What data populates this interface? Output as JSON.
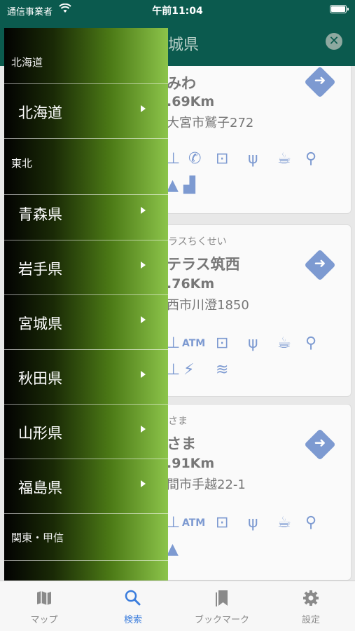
{
  "status_bar": {
    "carrier": "通信事業者",
    "time": "午前11:04"
  },
  "navbar": {
    "title": "城県"
  },
  "cards": [
    {
      "kana": "",
      "name": "みわ",
      "distance": ".69Km",
      "address": "大宮市鷲子272",
      "facilities": [
        "toilet-icon",
        "phone-icon",
        "shopping-bag-icon",
        "restaurant-icon",
        "cafe-icon",
        "water-tap-icon",
        "hill-icon",
        "landscape-icon"
      ]
    },
    {
      "kana": "ラスちくせい",
      "name": "テラス筑西",
      "distance": ".76Km",
      "address": "西市川澄1850",
      "facilities": [
        "toilet-icon",
        "atm-icon",
        "shopping-bag-icon",
        "restaurant-icon",
        "cafe-icon",
        "water-tap-icon",
        "toilet-icon",
        "ev-charger-icon",
        "wifi-icon"
      ],
      "atm_label": "ATM"
    },
    {
      "kana": "さま",
      "name": "さま",
      "distance": ".91Km",
      "address": "間市手越22-1",
      "facilities": [
        "toilet-icon",
        "atm-icon",
        "shopping-bag-icon",
        "restaurant-icon",
        "cafe-icon",
        "water-tap-icon",
        "hill-icon"
      ],
      "atm_label": "ATM"
    }
  ],
  "drawer": {
    "rows": [
      {
        "kind": "section",
        "label": "北海道"
      },
      {
        "kind": "item",
        "label": "北海道"
      },
      {
        "kind": "section",
        "label": "東北"
      },
      {
        "kind": "item",
        "label": "青森県"
      },
      {
        "kind": "item",
        "label": "岩手県"
      },
      {
        "kind": "item",
        "label": "宮城県"
      },
      {
        "kind": "item",
        "label": "秋田県"
      },
      {
        "kind": "item",
        "label": "山形県"
      },
      {
        "kind": "item",
        "label": "福島県"
      },
      {
        "kind": "section",
        "label": "関東・甲信"
      }
    ]
  },
  "tabbar": {
    "tabs": [
      {
        "label": "マップ",
        "icon": "map-icon",
        "active": false
      },
      {
        "label": "検索",
        "icon": "search-icon",
        "active": true
      },
      {
        "label": "ブックマーク",
        "icon": "bookmark-icon",
        "active": false
      },
      {
        "label": "設定",
        "icon": "gear-icon",
        "active": false
      }
    ]
  },
  "colors": {
    "nav": "#0b5a4e",
    "accent": "#3b7ddd",
    "facility": "#2a5cc4"
  }
}
